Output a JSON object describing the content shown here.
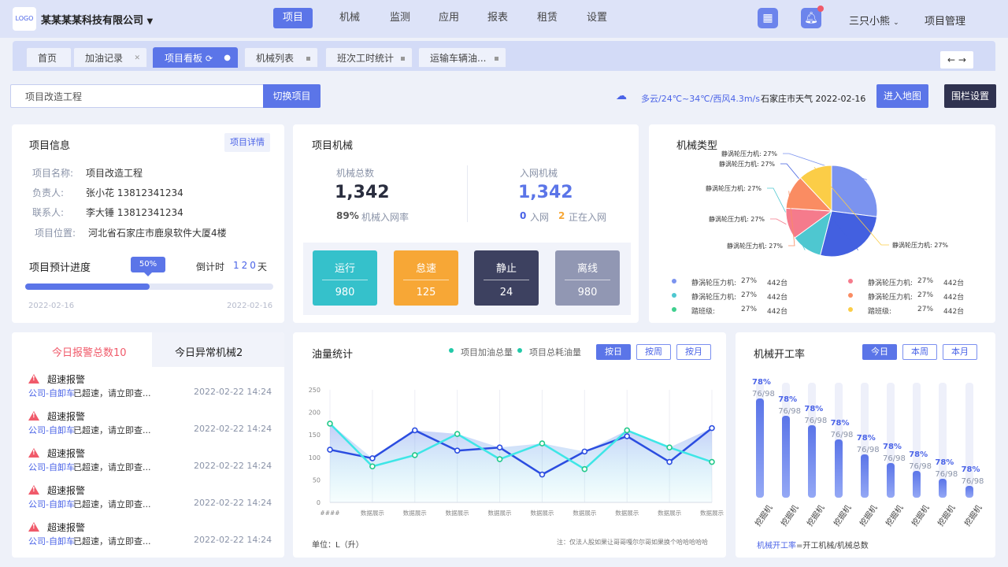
{
  "header": {
    "logo_text": "LOGO",
    "company": "某某某某科技有限公司",
    "nav": [
      "项目",
      "机械",
      "监测",
      "应用",
      "报表",
      "租赁",
      "设置"
    ],
    "user": "三只小熊",
    "project_mgmt": "项目管理"
  },
  "tabs": [
    {
      "label": "首页"
    },
    {
      "label": "加油记录"
    },
    {
      "label": "项目看板"
    },
    {
      "label": "机械列表"
    },
    {
      "label": "班次工时统计"
    },
    {
      "label": "运输车辆油..."
    }
  ],
  "toolbar": {
    "project_input_value": "项目改造工程",
    "switch_label": "切换项目",
    "weather": "多云/24℃~34℃/西风4.3m/s",
    "weather_city": "石家庄市天气 2022-02-16",
    "enter_map": "进入地图",
    "fence": "围栏设置"
  },
  "project_info": {
    "title": "项目信息",
    "detail_btn": "项目详情",
    "rows": [
      {
        "k": "项目名称:",
        "v": "项目改造工程"
      },
      {
        "k": "负责人:",
        "v": "张小花 13812341234"
      },
      {
        "k": "联系人:",
        "v": "李大锤 13812341234"
      },
      {
        "k": "项目位置:",
        "v": "河北省石家庄市鹿泉软件大厦4楼"
      }
    ],
    "progress_title": "项目预计进度",
    "progress_value": 0.5,
    "progress_label": "50%",
    "countdown_label": "倒计时",
    "countdown_value": "120",
    "countdown_unit": "天",
    "start_date": "2022-02-16",
    "end_date": "2022-02-16"
  },
  "machines": {
    "title": "项目机械",
    "total_label": "机械总数",
    "total_value": "1,342",
    "rate_value": "89%",
    "rate_label": "机械入网率",
    "net_label": "入网机械",
    "net_value": "1,342",
    "net_in": "0",
    "net_in_label": "入网",
    "net_pending": "2",
    "net_pending_label": "正在入网",
    "status": [
      {
        "label": "运行",
        "value": "980",
        "color": "#35c1cb"
      },
      {
        "label": "怠速",
        "value": "125",
        "color": "#f7a736"
      },
      {
        "label": "静止",
        "value": "24",
        "color": "#3d4160"
      },
      {
        "label": "离线",
        "value": "980",
        "color": "#9197b3"
      }
    ]
  },
  "machine_types": {
    "title": "机械类型",
    "slices": [
      {
        "label": "静涡轮压力机: 27%",
        "value": 27,
        "color": "#7b93ef"
      },
      {
        "label": "静涡轮压力机: 27%",
        "value": 27,
        "color": "#4360e0"
      },
      {
        "label": "静涡轮压力机: 27%",
        "value": 11,
        "color": "#4ec7d0"
      },
      {
        "label": "静涡轮压力机: 27%",
        "value": 11,
        "color": "#f57b8c"
      },
      {
        "label": "静涡轮压力机: 27%",
        "value": 12,
        "color": "#fa8c62"
      },
      {
        "label": "静涡轮压力机: 27%",
        "value": 12,
        "color": "#fbcd47"
      }
    ],
    "legend": [
      {
        "name": "静涡轮压力机:",
        "pct": "27%",
        "count": "442台",
        "color": "#7b93ef"
      },
      {
        "name": "静涡轮压力机:",
        "pct": "27%",
        "count": "442台",
        "color": "#f57b8c"
      },
      {
        "name": "静涡轮压力机:",
        "pct": "27%",
        "count": "442台",
        "color": "#4ec7d0"
      },
      {
        "name": "静涡轮压力机:",
        "pct": "27%",
        "count": "442台",
        "color": "#fa8c62"
      },
      {
        "name": "踏班级:",
        "pct": "27%",
        "count": "442台",
        "color": "#3fcf8e"
      },
      {
        "name": "踏班级:",
        "pct": "27%",
        "count": "442台",
        "color": "#fbcd47"
      }
    ]
  },
  "alarms": {
    "tab1": "今日报警总数10",
    "tab2": "今日异常机械2",
    "items": [
      {
        "title": "超速报警",
        "source": "公司-自卸车",
        "msg": "已超速，请立即查...",
        "time": "2022-02-22 14:24"
      },
      {
        "title": "超速报警",
        "source": "公司-自卸车",
        "msg": "已超速，请立即查...",
        "time": "2022-02-22 14:24"
      },
      {
        "title": "超速报警",
        "source": "公司-自卸车",
        "msg": "已超速，请立即查...",
        "time": "2022-02-22 14:24"
      },
      {
        "title": "超速报警",
        "source": "公司-自卸车",
        "msg": "已超速，请立即查...",
        "time": "2022-02-22 14:24"
      },
      {
        "title": "超速报警",
        "source": "公司-自卸车",
        "msg": "已超速，请立即查...",
        "time": "2022-02-22 14:24"
      }
    ]
  },
  "oil": {
    "title": "油量统计",
    "legend1": "项目加油总量",
    "legend2": "项目总耗油量",
    "btn_day": "按日",
    "btn_week": "按周",
    "btn_month": "按月",
    "unit": "单位：L（升）",
    "note": "注：仅法人股如果让哥哥嘎尔尔哥如果换个哈哈哈哈哈"
  },
  "rate": {
    "title": "机械开工率",
    "btn_day": "今日",
    "btn_week": "本周",
    "btn_month": "本月",
    "formula_key": "机械开工率",
    "formula_rest": "=开工机械/机械总数"
  },
  "chart_data": [
    {
      "type": "pie",
      "title": "机械类型",
      "categories": [
        "静涡轮压力机",
        "静涡轮压力机",
        "静涡轮压力机",
        "静涡轮压力机",
        "静涡轮压力机",
        "静涡轮压力机"
      ],
      "values": [
        27,
        27,
        11,
        11,
        12,
        12
      ],
      "labels": [
        "静涡轮压力机: 27%",
        "静涡轮压力机: 27%",
        "静涡轮压力机: 27%",
        "静涡轮压力机: 27%",
        "静涡轮压力机: 27%",
        "静涡轮压力机: 27%"
      ]
    },
    {
      "type": "area",
      "title": "油量统计",
      "categories": [
        "####",
        "数据展示",
        "数据展示",
        "数据展示",
        "数据展示",
        "数据展示",
        "数据展示",
        "数据展示",
        "数据展示",
        "数据展示"
      ],
      "ylim": [
        0,
        250
      ],
      "yticks": [
        0,
        50,
        100,
        150,
        200,
        250
      ],
      "series": [
        {
          "name": "项目加油总量",
          "color": "#2b4de0",
          "values": [
            117,
            98,
            160,
            115,
            122,
            62,
            113,
            147,
            90,
            165
          ]
        },
        {
          "name": "项目总耗油量",
          "color": "#3ee6e6",
          "values": [
            175,
            80,
            105,
            152,
            96,
            131,
            74,
            160,
            122,
            90
          ]
        }
      ]
    },
    {
      "type": "bar",
      "title": "机械开工率",
      "categories": [
        "挖掘机",
        "挖掘机",
        "挖掘机",
        "挖掘机",
        "挖掘机",
        "挖掘机",
        "挖掘机",
        "挖掘机",
        "挖掘机"
      ],
      "values": [
        0.85,
        0.7,
        0.62,
        0.5,
        0.37,
        0.3,
        0.23,
        0.16,
        0.1
      ],
      "pct_labels": [
        "78%",
        "78%",
        "78%",
        "78%",
        "78%",
        "78%",
        "78%",
        "78%",
        "78%"
      ],
      "sub_labels": [
        "76/98",
        "76/98",
        "76/98",
        "76/98",
        "76/98",
        "76/98",
        "76/98",
        "76/98",
        "76/98"
      ]
    }
  ]
}
